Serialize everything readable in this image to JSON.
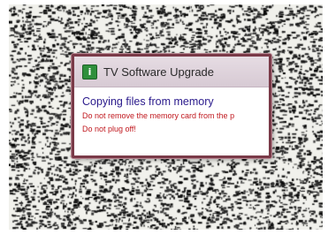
{
  "dialog": {
    "title": "TV Software Upgrade",
    "icon": "info-icon",
    "icon_glyph": "i",
    "status": "Copying  files from memory",
    "warning_line_1": "Do not remove the memory card from the p",
    "warning_line_2": "Do not plug off!"
  },
  "colors": {
    "dialog_border": "#7a3a48",
    "icon_background": "#2f8f3c",
    "status_text": "#2a1a8c",
    "warning_text": "#c0181e"
  }
}
